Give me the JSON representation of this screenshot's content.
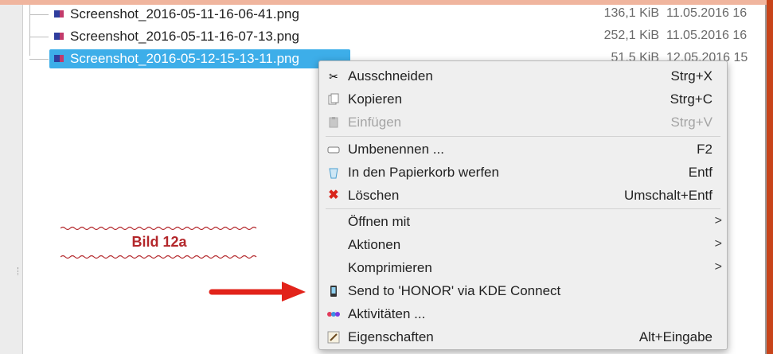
{
  "files": [
    {
      "name": "Screenshot_2016-05-11-16-06-41.png",
      "size": "136,1 KiB",
      "date": "11.05.2016 16",
      "selected": false
    },
    {
      "name": "Screenshot_2016-05-11-16-07-13.png",
      "size": "252,1 KiB",
      "date": "11.05.2016 16",
      "selected": false
    },
    {
      "name": "Screenshot_2016-05-12-15-13-11.png",
      "size": "51,5 KiB",
      "date": "12.05.2016 15",
      "selected": true
    }
  ],
  "context_menu": {
    "items": [
      {
        "label": "Ausschneiden",
        "shortcut": "Strg+X",
        "icon": "scissors-icon",
        "enabled": true
      },
      {
        "label": "Kopieren",
        "shortcut": "Strg+C",
        "icon": "copy-icon",
        "enabled": true
      },
      {
        "label": "Einfügen",
        "shortcut": "Strg+V",
        "icon": "paste-icon",
        "enabled": false
      },
      {
        "label": "Umbenennen ...",
        "shortcut": "F2",
        "icon": "rename-icon",
        "enabled": true
      },
      {
        "label": "In den Papierkorb werfen",
        "shortcut": "Entf",
        "icon": "trash-icon",
        "enabled": true
      },
      {
        "label": "Löschen",
        "shortcut": "Umschalt+Entf",
        "icon": "delete-icon",
        "enabled": true
      },
      {
        "label": "Öffnen mit",
        "submenu": true,
        "enabled": true
      },
      {
        "label": "Aktionen",
        "submenu": true,
        "enabled": true
      },
      {
        "label": "Komprimieren",
        "submenu": true,
        "enabled": true
      },
      {
        "label": "Send to 'HONOR' via KDE Connect",
        "icon": "phone-icon",
        "enabled": true
      },
      {
        "label": "Aktivitäten ...",
        "icon": "activities-icon",
        "enabled": true
      },
      {
        "label": "Eigenschaften",
        "shortcut": "Alt+Eingabe",
        "icon": "properties-icon",
        "enabled": true
      }
    ],
    "submenu_arrow": ">"
  },
  "annotation": {
    "caption": "Bild 12a"
  },
  "colors": {
    "selection": "#3daee9",
    "arrow": "#e2231a",
    "caption": "#b3262a",
    "delete_icon": "#d9261c"
  }
}
